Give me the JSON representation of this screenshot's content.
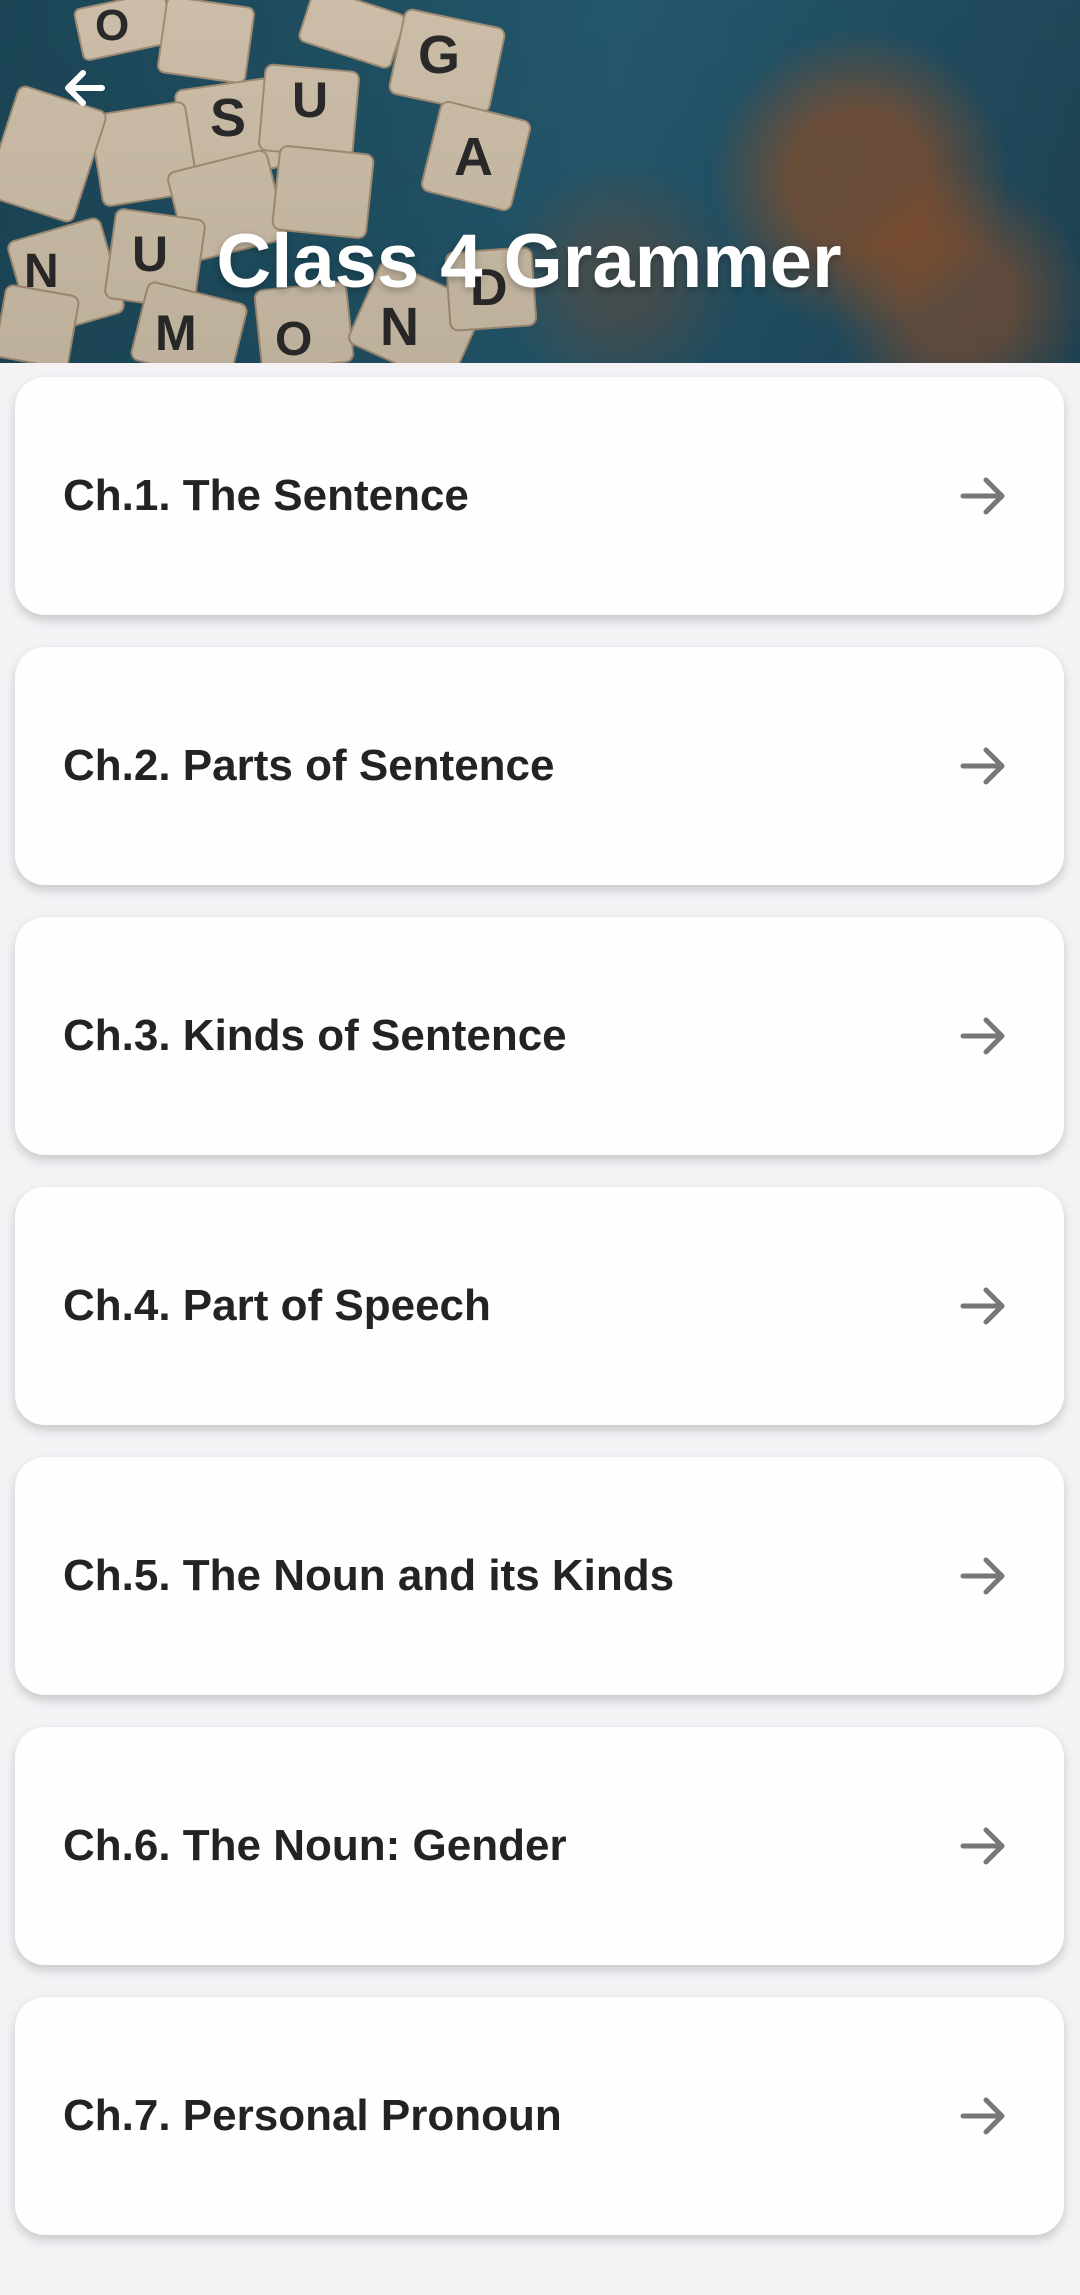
{
  "header": {
    "title": "Class 4 Grammer",
    "back_icon": "arrow-left-icon",
    "tiles": [
      "O",
      "G",
      "S",
      "U",
      "A",
      "N",
      "U",
      "M",
      "O",
      "N",
      "D"
    ],
    "accent_color": "#ffffff"
  },
  "chapters": [
    {
      "label": "Ch.1. The Sentence",
      "icon": "arrow-right-icon"
    },
    {
      "label": "Ch.2. Parts of Sentence",
      "icon": "arrow-right-icon"
    },
    {
      "label": "Ch.3. Kinds of Sentence",
      "icon": "arrow-right-icon"
    },
    {
      "label": "Ch.4. Part of Speech",
      "icon": "arrow-right-icon"
    },
    {
      "label": "Ch.5. The Noun and its Kinds",
      "icon": "arrow-right-icon"
    },
    {
      "label": "Ch.6. The Noun: Gender",
      "icon": "arrow-right-icon"
    },
    {
      "label": "Ch.7. Personal Pronoun",
      "icon": "arrow-right-icon"
    }
  ]
}
